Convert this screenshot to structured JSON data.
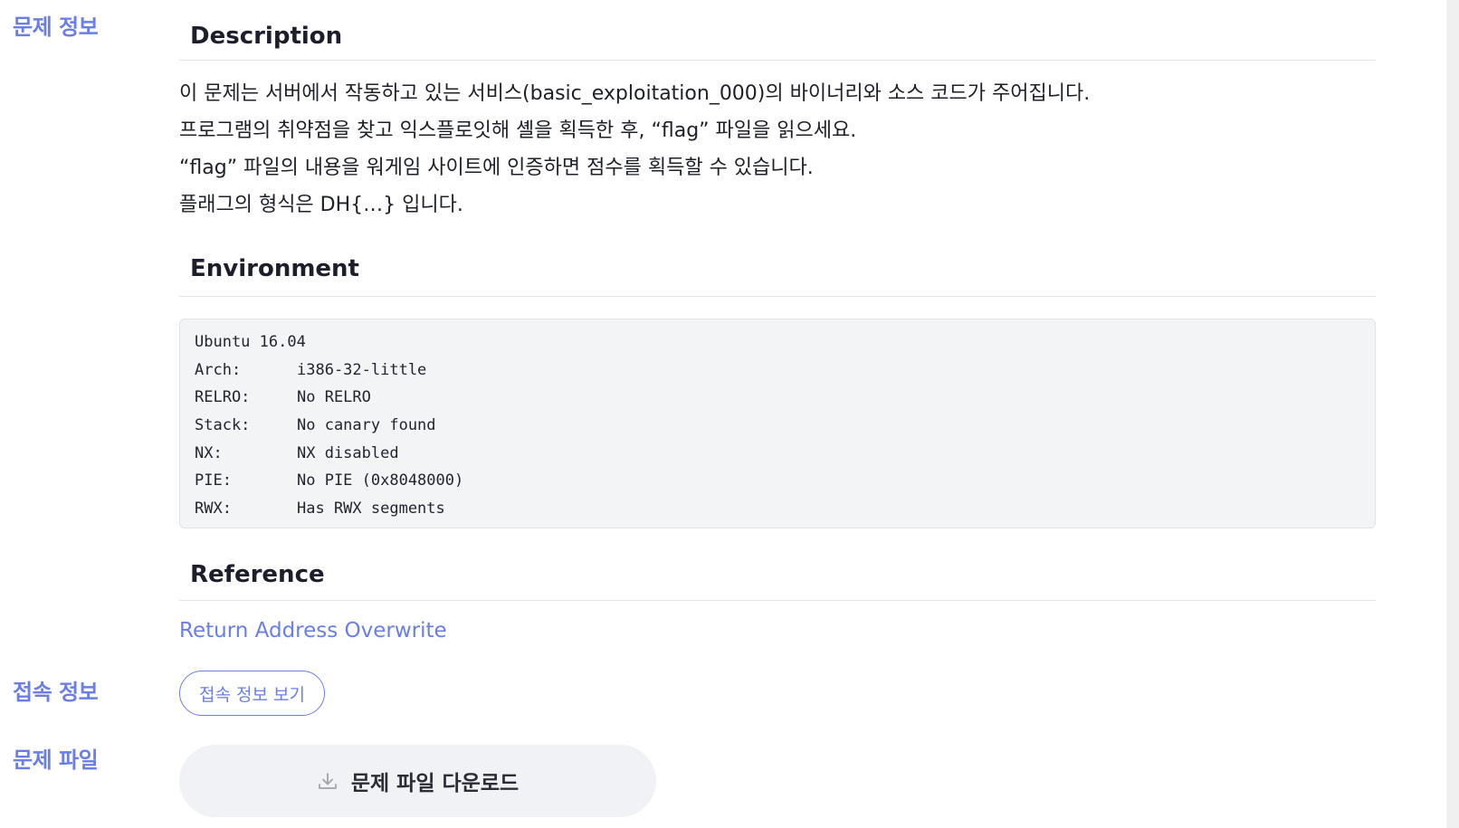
{
  "left_labels": {
    "problem_info": "문제 정보",
    "access_info": "접속 정보",
    "problem_file": "문제 파일"
  },
  "description": {
    "heading": "Description",
    "lines": [
      "이 문제는 서버에서 작동하고 있는 서비스(basic_exploitation_000)의 바이너리와 소스 코드가 주어집니다.",
      "프로그램의 취약점을 찾고 익스플로잇해 셸을 획득한 후, “flag” 파일을 읽으세요.",
      "“flag” 파일의 내용을 워게임 사이트에 인증하면 점수를 획득할 수 있습니다.",
      "플래그의 형식은 DH{…} 입니다."
    ]
  },
  "environment": {
    "heading": "Environment",
    "title_line": "Ubuntu 16.04",
    "rows": [
      {
        "key": "Arch:",
        "value": "i386-32-little"
      },
      {
        "key": "RELRO:",
        "value": "No RELRO"
      },
      {
        "key": "Stack:",
        "value": "No canary found"
      },
      {
        "key": "NX:",
        "value": "NX disabled"
      },
      {
        "key": "PIE:",
        "value": "No PIE (0x8048000)"
      },
      {
        "key": "RWX:",
        "value": "Has RWX segments"
      }
    ]
  },
  "reference": {
    "heading": "Reference",
    "link_text": "Return Address Overwrite"
  },
  "buttons": {
    "access_info": "접속 정보 보기",
    "download": "문제 파일 다운로드"
  },
  "colors": {
    "accent": "#6a7ee8",
    "code_bg": "#f3f4f6",
    "download_bg": "#f1f2f5"
  }
}
